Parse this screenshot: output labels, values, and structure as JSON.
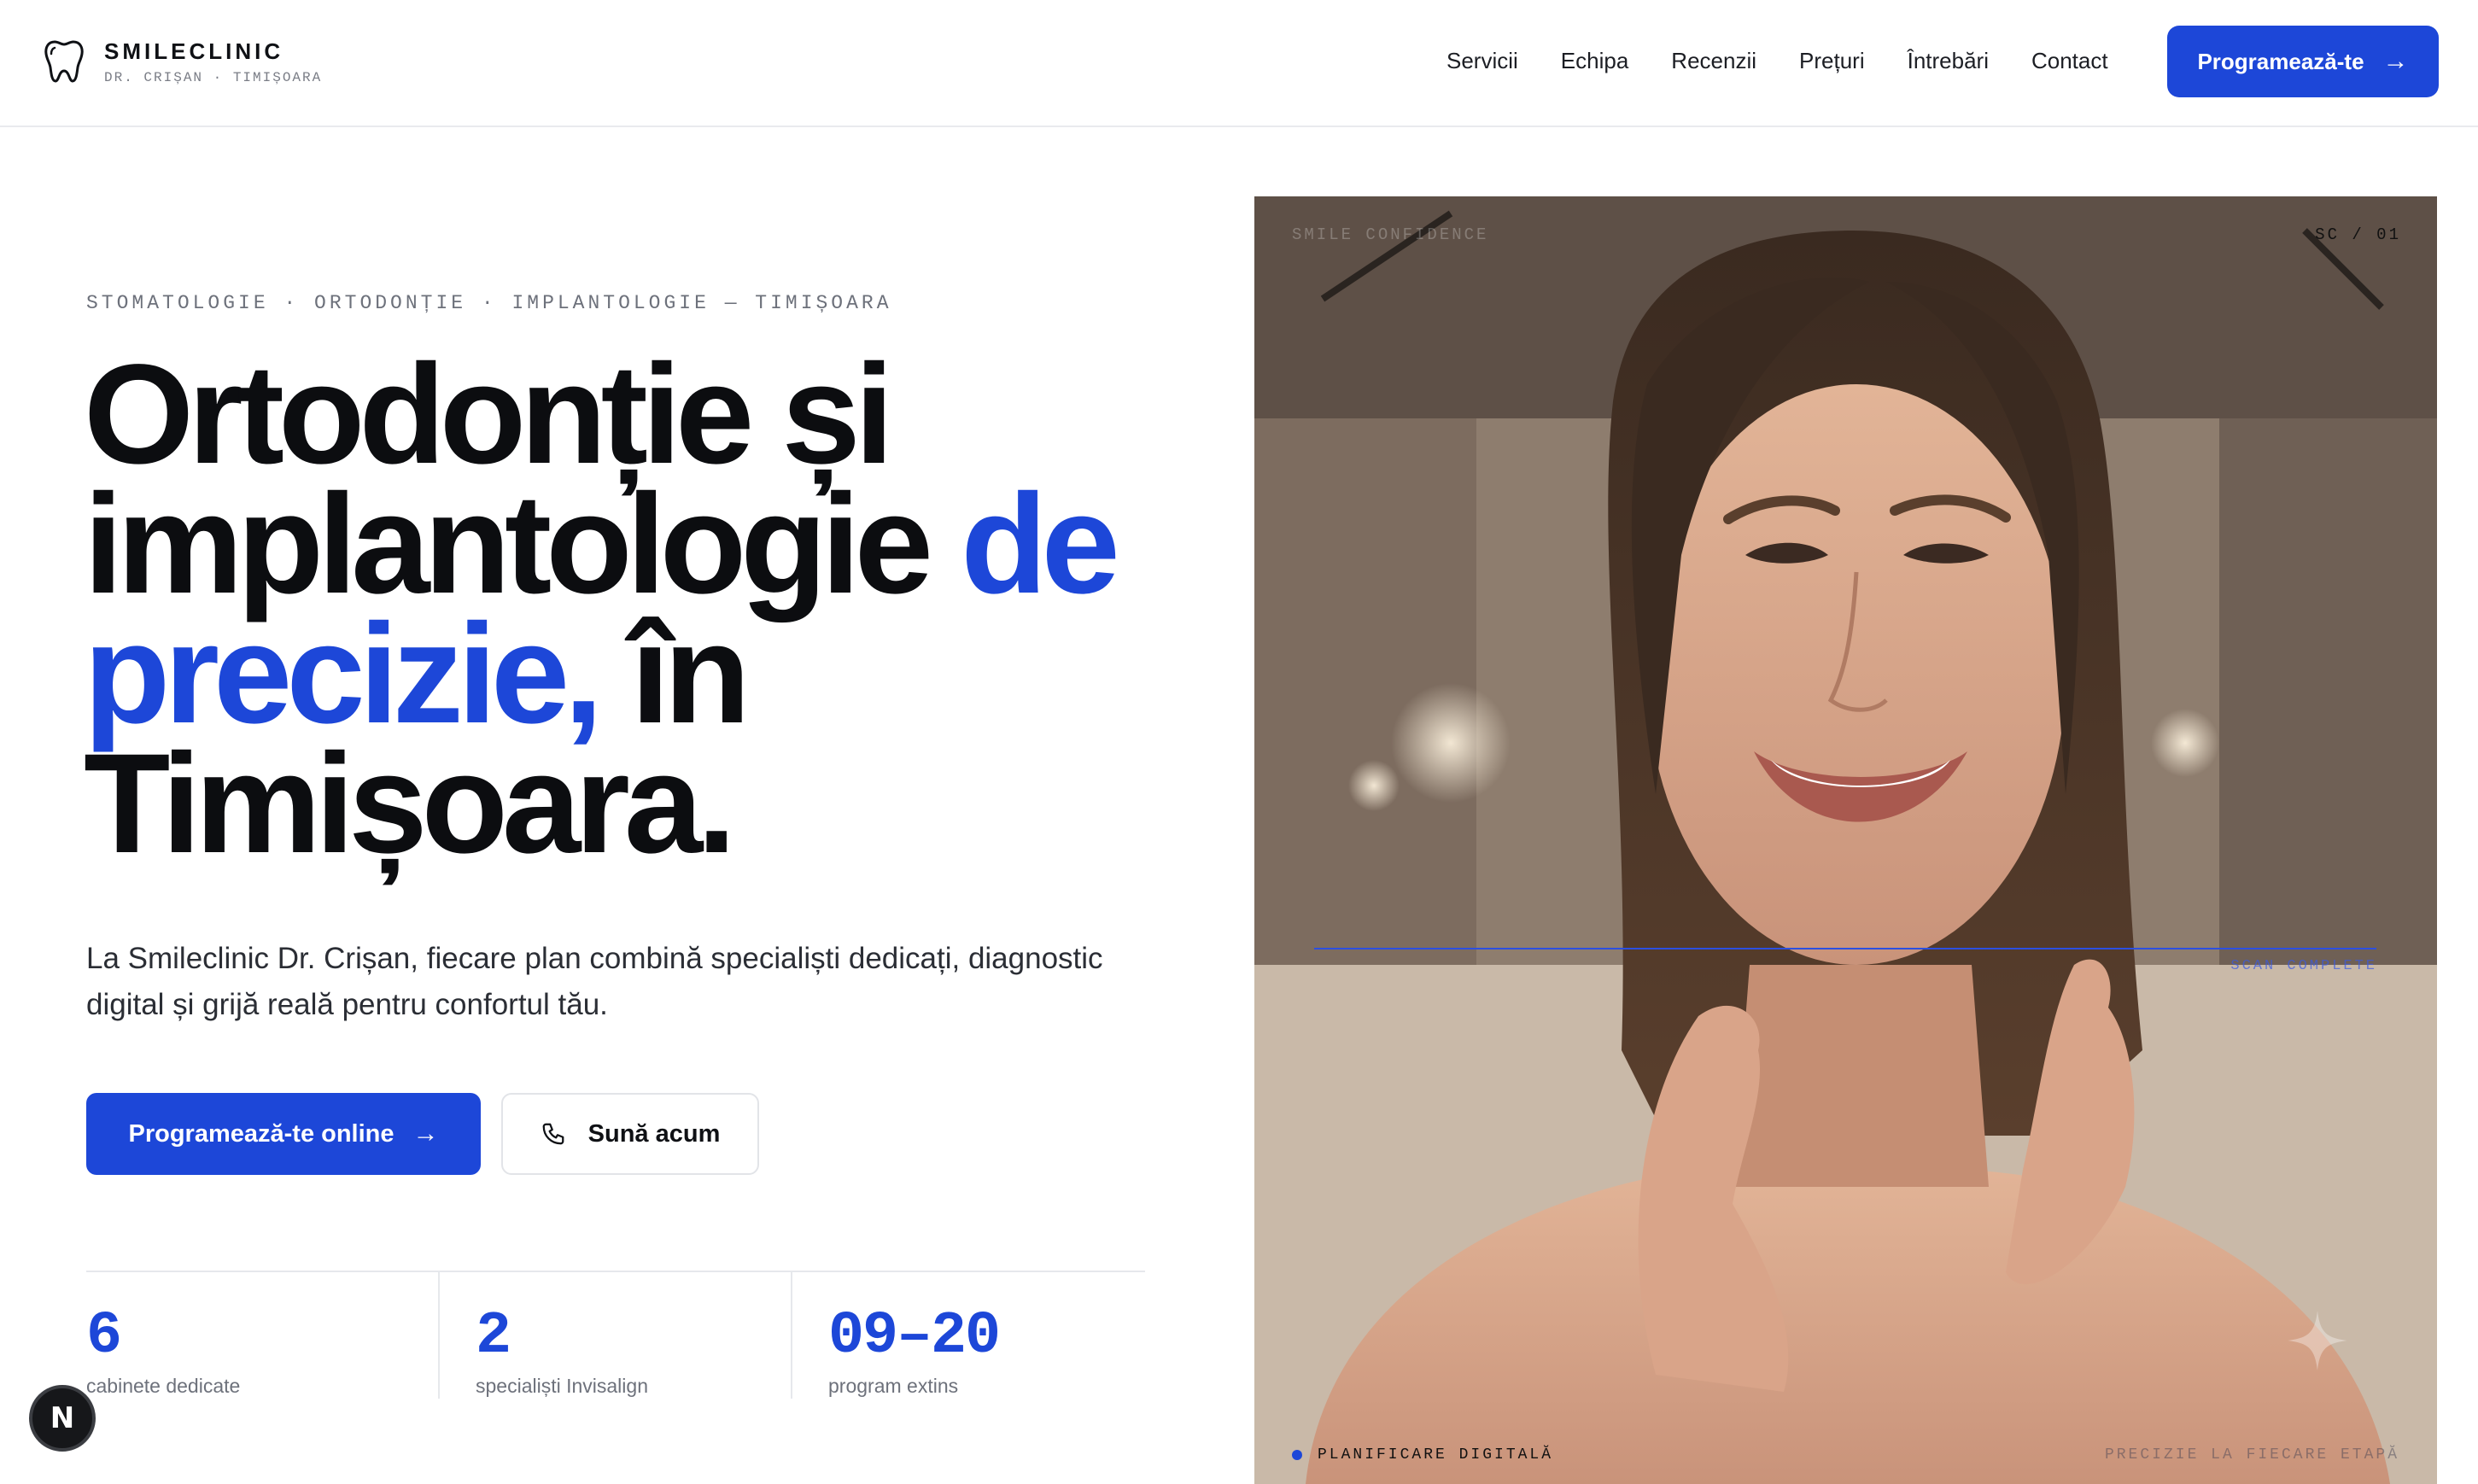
{
  "header": {
    "brand_name": "SMILECLINIC",
    "brand_sub": "DR. CRIȘAN · TIMIȘOARA",
    "nav": [
      "Servicii",
      "Echipa",
      "Recenzii",
      "Prețuri",
      "Întrebări",
      "Contact"
    ],
    "cta_label": "Programează-te"
  },
  "hero": {
    "eyebrow": "STOMATOLOGIE · ORTODONȚIE · IMPLANTOLOGIE — TIMIȘOARA",
    "headline_part1": "Ortodonție și implantologie ",
    "headline_accent": "de precizie,",
    "headline_part2": " în Timișoara.",
    "lead": "La Smileclinic Dr. Crișan, fiecare plan combină specialiști dedicați, diagnostic digital și grijă reală pentru confortul tău.",
    "primary_button": "Programează-te online",
    "secondary_button": "Sună acum",
    "stats": [
      {
        "value": "6",
        "label": "cabinete dedicate"
      },
      {
        "value": "2",
        "label": "specialiști Invisalign"
      },
      {
        "value": "09–20",
        "label": "program extins"
      }
    ]
  },
  "photo": {
    "label_top_left": "SMILE CONFIDENCE",
    "label_top_right": "SC / 01",
    "scan_label": "SCAN COMPLETE",
    "bottom_left": "PLANIFICARE DIGITALĂ",
    "bottom_right": "PRECIZIE LA FIECARE ETAPĂ"
  },
  "dev_badge": "N",
  "colors": {
    "accent": "#1d47d8",
    "text": "#0c0d10",
    "muted": "#6d717b"
  }
}
